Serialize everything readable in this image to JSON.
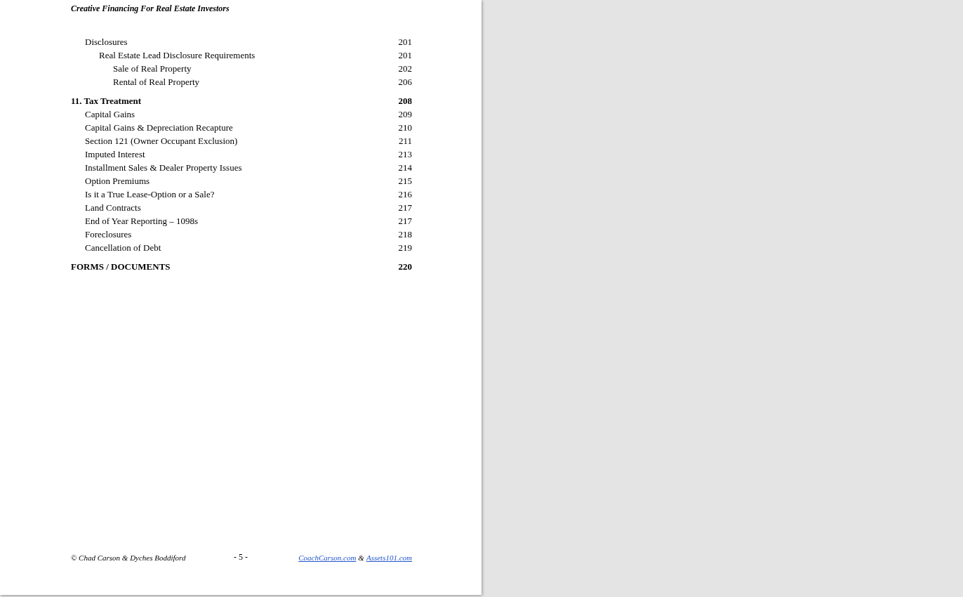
{
  "header": {
    "title": "Creative Financing For Real Estate Investors"
  },
  "toc": [
    {
      "kind": "section",
      "title": "Disclosures",
      "page": "201",
      "children": [
        {
          "title": "Real Estate Lead Disclosure Requirements",
          "page": "201",
          "children": [
            {
              "title": "Sale of Real Property",
              "page": "202"
            },
            {
              "title": "Rental of Real Property",
              "page": "206"
            }
          ]
        }
      ]
    },
    {
      "kind": "chapter",
      "title": "11.  Tax Treatment",
      "page": "208",
      "children": [
        {
          "title": "Capital Gains",
          "page": "209"
        },
        {
          "title": "Capital Gains & Depreciation Recapture",
          "page": "210"
        },
        {
          "title": "Section 121 (Owner Occupant Exclusion)",
          "page": "211"
        },
        {
          "title": "Imputed Interest",
          "page": "213"
        },
        {
          "title": "Installment Sales & Dealer Property Issues",
          "page": "214"
        },
        {
          "title": "Option Premiums",
          "page": "215"
        },
        {
          "title": "Is it a True Lease-Option or a Sale?",
          "page": "216"
        },
        {
          "title": "Land Contracts",
          "page": "217"
        },
        {
          "title": "End of Year Reporting – 1098s",
          "page": "217"
        },
        {
          "title": "Foreclosures",
          "page": "218"
        },
        {
          "title": "Cancellation of Debt",
          "page": "219"
        }
      ]
    },
    {
      "kind": "chapter",
      "title": "FORMS / DOCUMENTS",
      "page": "220"
    }
  ],
  "footer": {
    "copyright": "© Chad Carson & Dyches Boddiford",
    "page_number": "- 5 -",
    "links": [
      "CoachCarson.com ",
      "Assets101.com"
    ],
    "separator": "&"
  }
}
